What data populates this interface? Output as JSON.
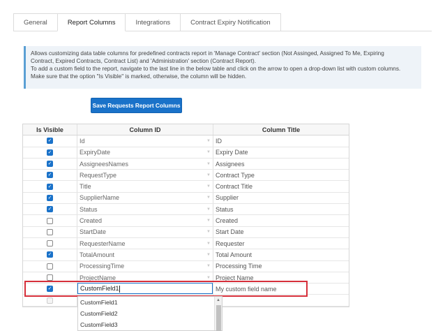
{
  "tabs": [
    "General",
    "Report Columns",
    "Integrations",
    "Contract Expiry Notification"
  ],
  "info": {
    "line1": "Allows customizing data table columns for predefined contracts report in 'Manage Contract' section (Not Assinged, Assigned To Me, Expiring",
    "line2": "Contract, Expired Contracts, Contract List) and 'Administration' section (Contract Report).",
    "line3": "To add a custom field to the report, navigate to the last line in the below table and click on the arrow to open a drop-down list with custom columns.",
    "line4": "Make sure that the option \"Is Visible\" is marked, otherwise, the column will be hidden."
  },
  "save_label": "Save Requests Report Columns",
  "grid": {
    "headers": [
      "Is Visible",
      "Column ID",
      "Column Title"
    ],
    "rows": [
      {
        "visible": true,
        "id": "Id",
        "title": "ID"
      },
      {
        "visible": true,
        "id": "ExpiryDate",
        "title": "Expiry Date"
      },
      {
        "visible": true,
        "id": "AssigneesNames",
        "title": "Assignees"
      },
      {
        "visible": true,
        "id": "RequestType",
        "title": "Contract Type"
      },
      {
        "visible": true,
        "id": "Title",
        "title": "Contract Title"
      },
      {
        "visible": true,
        "id": "SupplierName",
        "title": "Supplier"
      },
      {
        "visible": true,
        "id": "Status",
        "title": "Status"
      },
      {
        "visible": false,
        "id": "Created",
        "title": "Created"
      },
      {
        "visible": false,
        "id": "StartDate",
        "title": "Start Date"
      },
      {
        "visible": false,
        "id": "RequesterName",
        "title": "Requester"
      },
      {
        "visible": true,
        "id": "TotalAmount",
        "title": "Total Amount"
      },
      {
        "visible": false,
        "id": "ProcessingTime",
        "title": "Processing Time"
      },
      {
        "visible": false,
        "id": "ProjectName",
        "title": "Project Name"
      }
    ],
    "edit_row": {
      "visible": true,
      "id": "CustomField1",
      "title": "My custom field name"
    }
  },
  "dropdown": [
    "CustomField1",
    "CustomField2",
    "CustomField3"
  ],
  "colors": {
    "accent": "#1a72c9",
    "highlight": "#d62f3a"
  }
}
